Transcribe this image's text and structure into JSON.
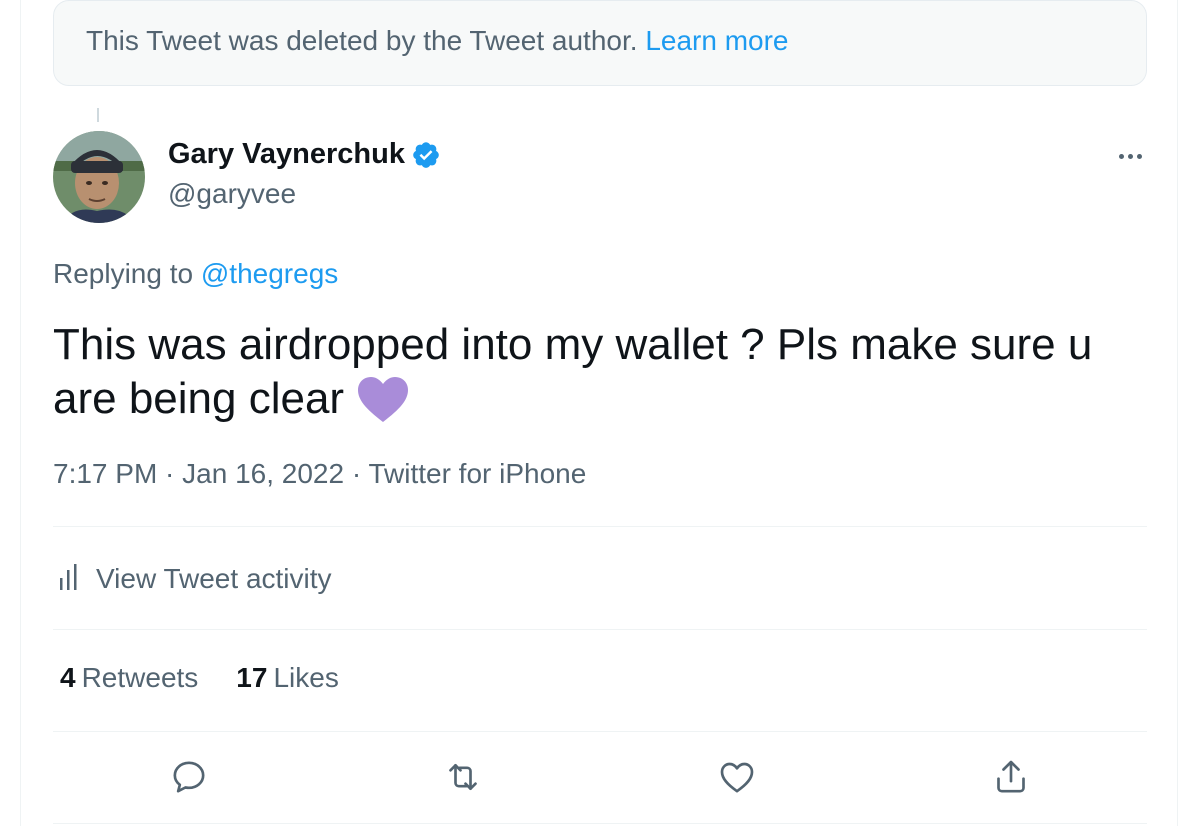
{
  "notice": {
    "text": "This Tweet was deleted by the Tweet author.",
    "link": "Learn more"
  },
  "author": {
    "name": "Gary Vaynerchuk",
    "handle": "@garyvee",
    "verified": true
  },
  "reply": {
    "prefix": "Replying to",
    "mention": "@thegregs"
  },
  "tweet": {
    "text": "This was airdropped into my wallet ? Pls make sure u are being clear",
    "emoji": "purple-heart-emoji"
  },
  "meta": {
    "timestamp": "7:17 PM · Jan 16, 2022 · Twitter for iPhone"
  },
  "activity": {
    "label": "View Tweet activity"
  },
  "stats": {
    "retweets_count": "4",
    "retweets_label": "Retweets",
    "likes_count": "17",
    "likes_label": "Likes"
  },
  "actions": [
    "reply-icon",
    "retweet-icon",
    "like-icon",
    "share-icon"
  ],
  "colors": {
    "accent": "#1d9bf0",
    "text": "#0f1419",
    "secondary": "#536471",
    "heart": "#a98cd9"
  }
}
